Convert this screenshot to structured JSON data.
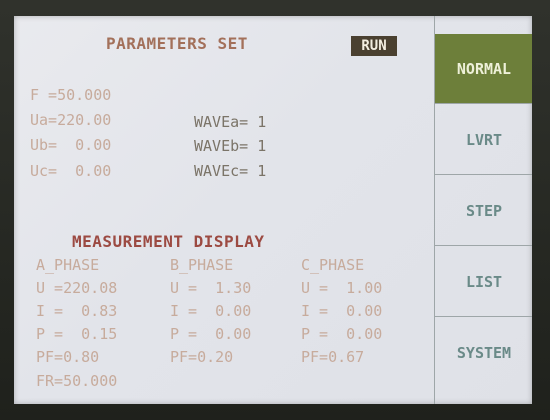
{
  "header": {
    "title": "PARAMETERS SET",
    "run_badge": "RUN"
  },
  "params": {
    "f": "F =50.000",
    "ua": "Ua=220.00",
    "ub": "Ub=  0.00",
    "uc": "Uc=  0.00",
    "wave_a": "WAVEa= 1",
    "wave_b": "WAVEb= 1",
    "wave_c": "WAVEc= 1"
  },
  "measurement": {
    "heading": "MEASUREMENT DISPLAY",
    "a_phase": {
      "header": "A_PHASE",
      "u": "U =220.08",
      "i": "I =  0.83",
      "p": "P =  0.15",
      "pf": "PF=0.80"
    },
    "b_phase": {
      "header": "B_PHASE",
      "u": "U =  1.30",
      "i": "I =  0.00",
      "p": "P =  0.00",
      "pf": "PF=0.20"
    },
    "c_phase": {
      "header": "C_PHASE",
      "u": "U =  1.00",
      "i": "I =  0.00",
      "p": "P =  0.00",
      "pf": "PF=0.67"
    },
    "fr": "FR=50.000"
  },
  "sidebar": {
    "items": [
      {
        "label": "NORMAL",
        "active": true
      },
      {
        "label": "LVRT",
        "active": false
      },
      {
        "label": "STEP",
        "active": false
      },
      {
        "label": "LIST",
        "active": false
      },
      {
        "label": "SYSTEM",
        "active": false
      }
    ]
  },
  "colors": {
    "screen_bg": "#e4e6ec",
    "title": "#a3705a",
    "measurement_heading": "#9c4a42",
    "active_tab": "#6d7f3a",
    "tab_text": "#6a8a88",
    "run_badge_bg": "#4a4030"
  }
}
